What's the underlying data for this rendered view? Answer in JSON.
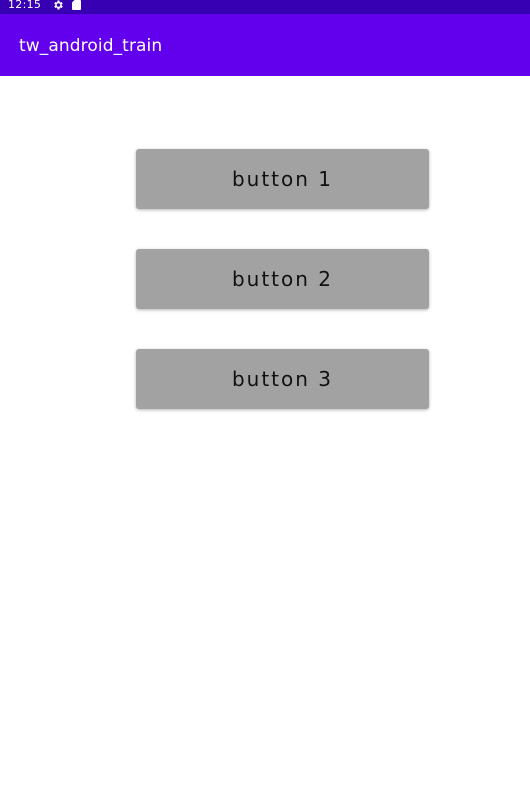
{
  "status_bar": {
    "time": "12:15",
    "icons": [
      "gear-icon",
      "sd-card-icon"
    ],
    "color": "#3700b3"
  },
  "app_bar": {
    "title": "tw_android_train",
    "color": "#6200ee"
  },
  "buttons": [
    {
      "label": "button 1"
    },
    {
      "label": "button 2"
    },
    {
      "label": "button 3"
    }
  ],
  "button_color": "#a2a2a2"
}
